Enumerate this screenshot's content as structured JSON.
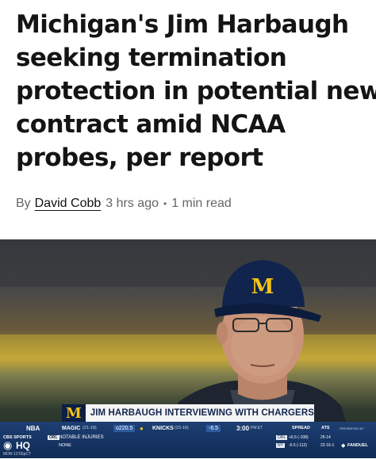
{
  "article": {
    "headline_lines": [
      "Michigan's Jim Harbaugh",
      "seeking termination",
      "protection in potential new",
      "contract amid NCAA",
      "probes, per report"
    ],
    "byline_prefix": "By",
    "author": "David Cobb",
    "published": "3 hrs ago",
    "separator": "•",
    "read_time": "1 min read"
  },
  "broadcast": {
    "cap_logo_letter": "M",
    "lower_third_text": "JIM HARBAUGH INTERVIEWING WITH CHARGERS",
    "logo_letter": "M",
    "ticker": {
      "league": "NBA",
      "network": "CBS SPORTS",
      "network_short": "HQ",
      "local_time": "MON 12:55pCT",
      "away_team": "MAGIC",
      "away_record": "(21-18)",
      "total": "o220.5",
      "home_team": "KNICKS",
      "home_record": "(23-16)",
      "home_spread": "-6.5",
      "game_time": "3:00",
      "game_time_suffix": "PM ET",
      "notes_team": "ORL",
      "notes_label": "NOTABLE INJURIES",
      "notes_value": "NONE",
      "spread_header": "SPREAD",
      "ats_header": "ATS",
      "presented_by": "PRESENTED BY",
      "rows": [
        {
          "team": "ORL",
          "spread": "+6.5 (-108)",
          "ats": "25-14"
        },
        {
          "team": "NY",
          "spread": "-6.5 (-112)",
          "ats": "22-16-1"
        }
      ],
      "sponsor": "FANDUEL"
    }
  },
  "colors": {
    "michigan_maize": "#f3c317",
    "michigan_blue": "#0c1f45",
    "ticker_blue": "#1e3f73"
  }
}
